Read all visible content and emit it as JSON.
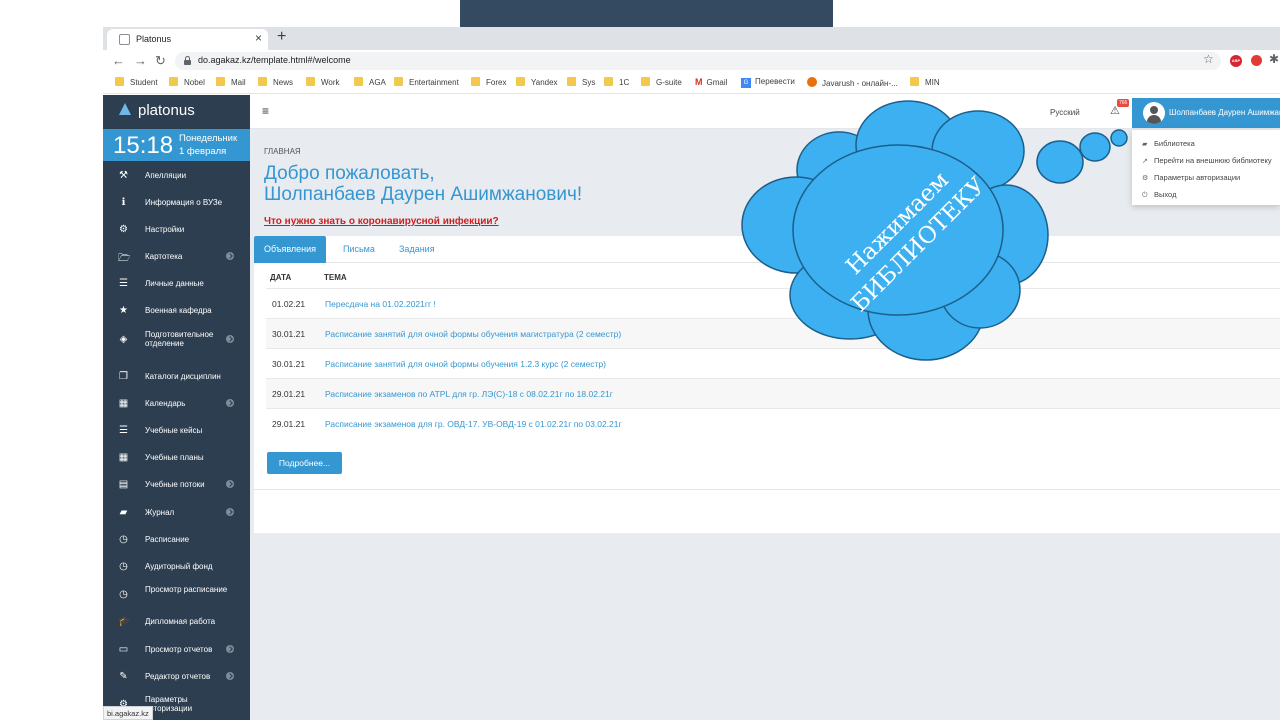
{
  "browser": {
    "tab_title": "Platonus",
    "tab_close": "×",
    "new_tab": "+",
    "url": "do.agakaz.kz/template.html#/welcome",
    "bookmarks": [
      "Student",
      "Nobel",
      "Mail",
      "News",
      "Work",
      "AGA",
      "Entertainment",
      "Forex",
      "Yandex",
      "Sys",
      "1C",
      "G-suite",
      "Gmail",
      "Перевести",
      "Javarush - онлайн-...",
      "MIN"
    ],
    "status_url": "bi.agakaz.kz",
    "ext_abp": "ABP"
  },
  "sidebar": {
    "logo": "platonus",
    "time": "15:18",
    "day": "Понедельник",
    "date": "1 февраля",
    "items": [
      {
        "label": "Апелляции",
        "icon": "gavel-icon",
        "glyph": "⚒",
        "chevron": false
      },
      {
        "label": "Информация о ВУЗе",
        "icon": "info-icon",
        "glyph": "ℹ",
        "chevron": false
      },
      {
        "label": "Настройки",
        "icon": "cogs-icon",
        "glyph": "⚙",
        "chevron": false
      },
      {
        "label": "Картотека",
        "icon": "folder-open-icon",
        "glyph": "🗁",
        "chevron": true
      },
      {
        "label": "Личные данные",
        "icon": "list-icon",
        "glyph": "☰",
        "chevron": false
      },
      {
        "label": "Военная кафедра",
        "icon": "star-icon",
        "glyph": "★",
        "chevron": false
      },
      {
        "label": "Подготовительное отделение",
        "icon": "cube-icon",
        "glyph": "◈",
        "chevron": true
      },
      {
        "label": "Каталоги дисциплин",
        "icon": "copy-icon",
        "glyph": "❐",
        "chevron": false
      },
      {
        "label": "Календарь",
        "icon": "calendar-icon",
        "glyph": "▦",
        "chevron": true
      },
      {
        "label": "Учебные кейсы",
        "icon": "list-icon",
        "glyph": "☰",
        "chevron": false
      },
      {
        "label": "Учебные планы",
        "icon": "th-icon",
        "glyph": "▦",
        "chevron": false
      },
      {
        "label": "Учебные потоки",
        "icon": "file-icon",
        "glyph": "▤",
        "chevron": true
      },
      {
        "label": "Журнал",
        "icon": "book-icon",
        "glyph": "▰",
        "chevron": true
      },
      {
        "label": "Расписание",
        "icon": "clock-icon",
        "glyph": "◷",
        "chevron": false
      },
      {
        "label": "Аудиторный фонд",
        "icon": "clock-icon",
        "glyph": "◷",
        "chevron": false
      },
      {
        "label": "Просмотр расписание",
        "icon": "clock-icon",
        "glyph": "◷",
        "chevron": false
      },
      {
        "label": "Дипломная работа",
        "icon": "graduation-cap-icon",
        "glyph": "🎓",
        "chevron": false
      },
      {
        "label": "Просмотр отчетов",
        "icon": "credit-card-icon",
        "glyph": "▭",
        "chevron": true
      },
      {
        "label": "Редактор отчетов",
        "icon": "edit-icon",
        "glyph": "✎",
        "chevron": true
      },
      {
        "label": "Параметры авторизации",
        "icon": "cog-icon",
        "glyph": "⚙",
        "chevron": false
      }
    ]
  },
  "header": {
    "menu_glyph": "≡",
    "language": "Русский",
    "notifications_count": "766",
    "user_name": "Шолпанбаев Даурен Ашимжанович"
  },
  "user_menu": [
    {
      "label": "Библиотека",
      "icon": "book-icon",
      "glyph": "▰"
    },
    {
      "label": "Перейти на внешнюю библиотеку",
      "icon": "external-link-icon",
      "glyph": "↗"
    },
    {
      "label": "Параметры авторизации",
      "icon": "cog-icon",
      "glyph": "⚙"
    },
    {
      "label": "Выход",
      "icon": "power-icon",
      "glyph": "⏻"
    }
  ],
  "page": {
    "breadcrumb": "ГЛАВНАЯ",
    "welcome_line1": "Добро пожаловать,",
    "welcome_line2": "Шолпанбаев Даурен Ашимжанович!",
    "covid_link": "Что нужно знать о коронавирусной инфекции?",
    "tabs": [
      "Объявления",
      "Письма",
      "Задания"
    ],
    "columns": [
      "ДАТА",
      "ТЕМА"
    ],
    "announcements": [
      {
        "date": "01.02.21",
        "topic": "Пересдача на 01.02.2021гг !"
      },
      {
        "date": "30.01.21",
        "topic": "Расписание занятий для очной формы обучения магистратура (2 семестр)"
      },
      {
        "date": "30.01.21",
        "topic": "Расписание занятий для очной формы обучения 1.2.3 курс (2 семестр)"
      },
      {
        "date": "29.01.21",
        "topic": "Расписание экзаменов по ATPL для гр. ЛЭ(С)-18 с 08.02.21г по 18.02.21г"
      },
      {
        "date": "29.01.21",
        "topic": "Расписание экзаменов для гр. ОВД-17. УВ-ОВД-19 с 01.02.21г по 03.02.21г"
      }
    ],
    "more_button": "Подробнее..."
  },
  "callout": {
    "line1": "Нажимаем",
    "line2": "БИБЛИОТЕКУ",
    "fill": "#3cb0f0",
    "stroke": "#1c5f8a"
  }
}
